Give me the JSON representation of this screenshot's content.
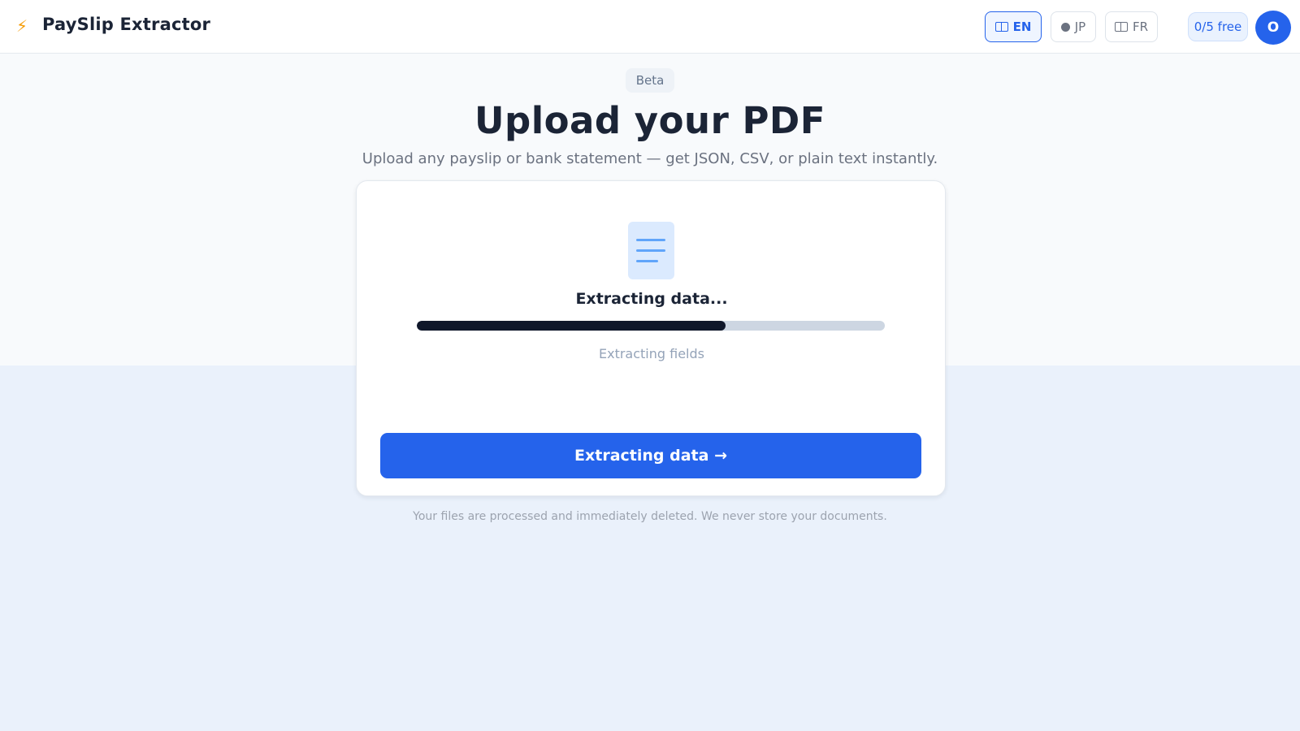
{
  "header": {
    "brand": "PaySlip Extractor",
    "logo_icon": "lightning-icon",
    "languages": [
      {
        "code": "EN",
        "icon": "flag-icon",
        "active": true
      },
      {
        "code": "JP",
        "icon": "dot-icon",
        "active": false
      },
      {
        "code": "FR",
        "icon": "flag-icon",
        "active": false
      }
    ],
    "quota": "0/5 free",
    "avatar_initial": "O"
  },
  "hero": {
    "badge": "Beta",
    "title": "Upload your PDF",
    "subtitle": "Upload any payslip or bank statement — get JSON, CSV, or plain text instantly."
  },
  "card": {
    "icon": "document-icon",
    "status": "Extracting data...",
    "progress_percent": 66,
    "progress_label": "Extracting fields",
    "button_label": "Extracting data →"
  },
  "footer_note": "Your files are processed and immediately deleted. We never store your documents.",
  "colors": {
    "accent": "#2563eb",
    "logo": "#f59e0b",
    "progress_fill": "#0f172a",
    "progress_track": "#cdd6e2",
    "page_background": "#eaf1fb"
  }
}
